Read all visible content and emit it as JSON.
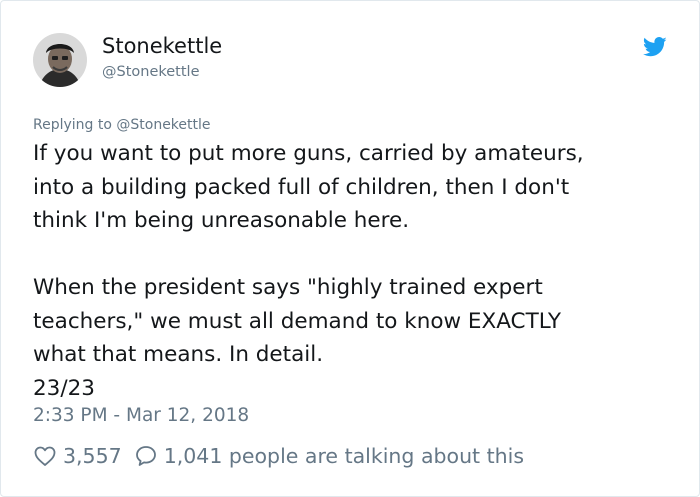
{
  "user": {
    "display_name": "Stonekettle",
    "handle": "@Stonekettle"
  },
  "reply": {
    "replying_to": "Replying to @Stonekettle"
  },
  "tweet": {
    "text": "If you want to put more guns, carried by amateurs,\ninto a building packed full of children, then I don't\nthink I'm being unreasonable here.\n\nWhen the president says \"highly trained expert\nteachers,\" we must all demand to know EXACTLY\nwhat that means. In detail.\n23/23"
  },
  "meta": {
    "timestamp": "2:33 PM - Mar 12, 2018"
  },
  "stats": {
    "likes": "3,557",
    "replies_text": "1,041 people are talking about this"
  },
  "colors": {
    "brand": "#1da1f2",
    "secondary_text": "#657786",
    "primary_text": "#14171a"
  },
  "icons": {
    "platform": "twitter-bird-icon",
    "like": "heart-icon",
    "reply": "speech-bubble-icon"
  }
}
